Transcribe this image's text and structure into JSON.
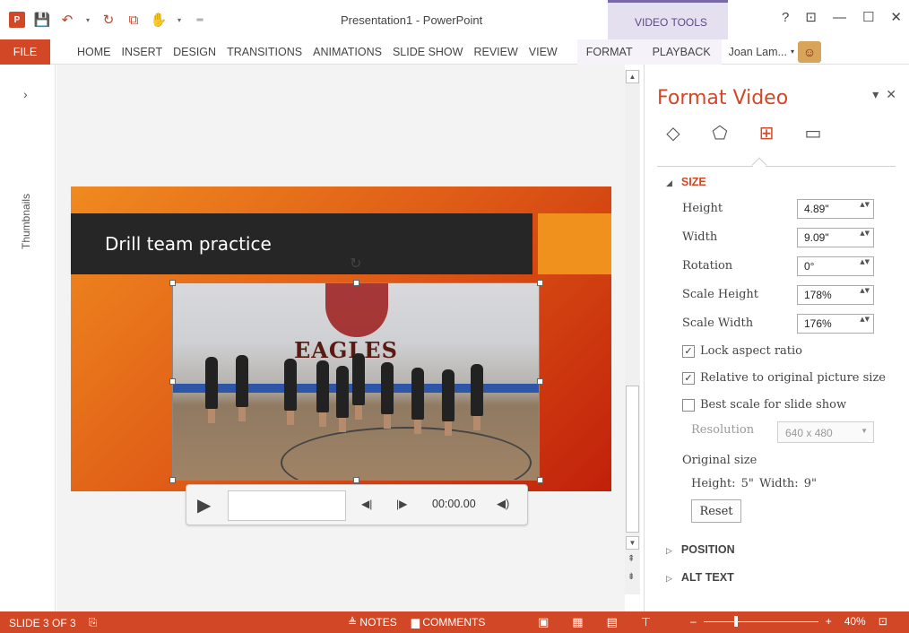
{
  "titlebar": {
    "title": "Presentation1 - PowerPoint",
    "context_tab": "VIDEO TOOLS",
    "help": "?",
    "restore_ribbon": "⊡",
    "minimize": "—",
    "maximize": "☐",
    "close": "✕",
    "qat": {
      "save": "💾",
      "undo": "↶",
      "undo_arrow": "▾",
      "repeat": "↻",
      "present": "⧉",
      "touch": "✋",
      "touch_arrow": "▾",
      "customize": "═"
    },
    "app_logo": "P"
  },
  "tabs": [
    "FILE",
    "HOME",
    "INSERT",
    "DESIGN",
    "TRANSITIONS",
    "ANIMATIONS",
    "SLIDE SHOW",
    "REVIEW",
    "VIEW"
  ],
  "context_tabs": [
    "FORMAT",
    "PLAYBACK"
  ],
  "user": {
    "name": "Joan Lam...",
    "arrow": "▾",
    "avatar_glyph": "☺"
  },
  "thumbnails": {
    "chevron": "›",
    "label": "Thumbnails"
  },
  "slide": {
    "title": "Drill team practice",
    "video_logo": "EAGLES",
    "rotate_glyph": "↻"
  },
  "player": {
    "play": "▶",
    "prev": "◀|",
    "next": "|▶",
    "time": "00:00.00",
    "volume": "◀)"
  },
  "scroll": {
    "up": "▲",
    "down": "▼",
    "page_up": "⇞",
    "page_down": "⇟"
  },
  "pane": {
    "title": "Format Video",
    "ctrl_menu": "▾",
    "ctrl_close": "✕",
    "icons": {
      "fill": "◇",
      "effects": "⬠",
      "size": "⊞",
      "video": "▭"
    },
    "size_section": "SIZE",
    "size_tri": "◢",
    "fields": [
      {
        "label": "Height",
        "value": "4.89\""
      },
      {
        "label": "Width",
        "value": "9.09\""
      },
      {
        "label": "Rotation",
        "value": "0°"
      },
      {
        "label": "Scale Height",
        "value": "178%"
      },
      {
        "label": "Scale Width",
        "value": "176%"
      }
    ],
    "spin_arrows": "▲▼",
    "checks": [
      {
        "label": "Lock aspect ratio",
        "checked": "✓"
      },
      {
        "label": "Relative to original picture size",
        "checked": "✓"
      },
      {
        "label": "Best scale for slide show",
        "checked": ""
      }
    ],
    "resolution_label": "Resolution",
    "resolution_value": "640 x 480",
    "resolution_arrow": "▼",
    "original_size": "Original size",
    "original_dims": "Height:  5\"  Width:  9\"",
    "reset": "Reset",
    "position_section": "POSITION",
    "alttext_section": "ALT TEXT",
    "collapsed_tri": "▷"
  },
  "status": {
    "slide": "SLIDE 3 OF 3",
    "spell_icon": "⎘",
    "notes": "NOTES",
    "notes_icon": "≜",
    "comments": "COMMENTS",
    "comments_icon": "▆",
    "views": {
      "normal": "▣",
      "sorter": "▦",
      "reading": "▤",
      "slideshow": "⊤"
    },
    "zoom_minus": "–",
    "zoom_plus": "+",
    "zoom": "40%",
    "fit": "⊡"
  },
  "colors": {
    "accent": "#d24726",
    "context": "#7b68a6"
  }
}
